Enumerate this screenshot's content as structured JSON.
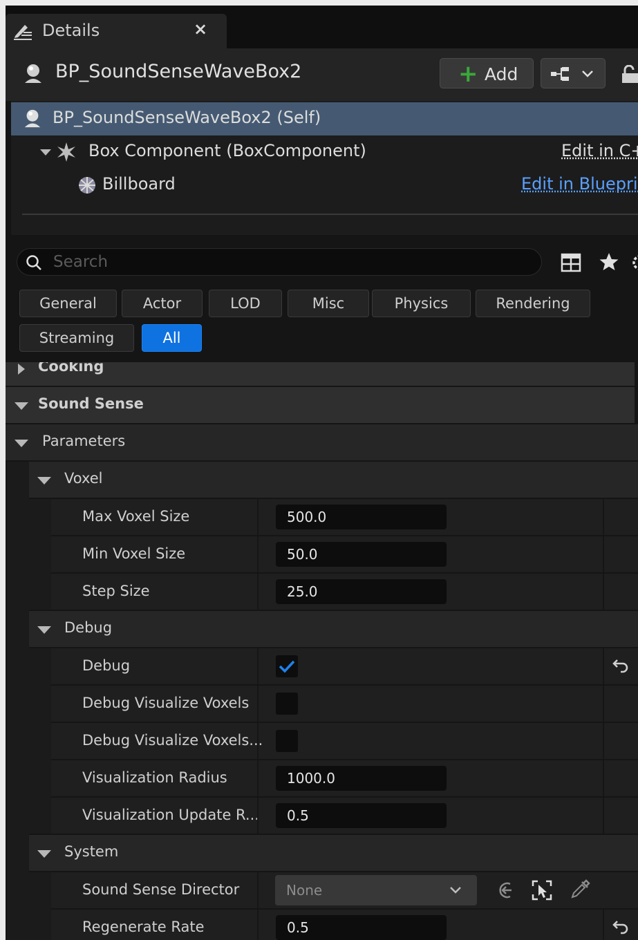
{
  "tab": {
    "title": "Details",
    "close": "×"
  },
  "header": {
    "actor_name": "BP_SoundSenseWaveBox2",
    "add_label": "Add",
    "add_symbol": "+"
  },
  "tree": {
    "self_label": "BP_SoundSenseWaveBox2 (Self)",
    "box_label": "Box Component (BoxComponent)",
    "box_link": "Edit in C++",
    "billboard_label": "Billboard",
    "billboard_link": "Edit in Blueprint"
  },
  "search": {
    "placeholder": "Search"
  },
  "filters": [
    "General",
    "Actor",
    "LOD",
    "Misc",
    "Physics",
    "Rendering",
    "Streaming",
    "All"
  ],
  "active_filter": "All",
  "categories": {
    "cooking": "Cooking",
    "sound_sense": "Sound Sense"
  },
  "parameters": {
    "label": "Parameters",
    "voxel": {
      "label": "Voxel",
      "max_voxel_size": {
        "label": "Max Voxel Size",
        "value": "500.0"
      },
      "min_voxel_size": {
        "label": "Min Voxel Size",
        "value": "50.0"
      },
      "step_size": {
        "label": "Step Size",
        "value": "25.0"
      }
    },
    "debug": {
      "label": "Debug",
      "debug": {
        "label": "Debug",
        "checked": true
      },
      "debug_visualize_voxels": {
        "label": "Debug Visualize Voxels",
        "checked": false
      },
      "debug_visualize_voxels_2": {
        "label": "Debug Visualize Voxels...",
        "checked": false
      },
      "visualization_radius": {
        "label": "Visualization Radius",
        "value": "1000.0"
      },
      "visualization_update_rate": {
        "label": "Visualization Update R...",
        "value": "0.5"
      }
    },
    "system": {
      "label": "System",
      "sound_sense_director": {
        "label": "Sound Sense Director",
        "value": "None"
      },
      "regenerate_rate": {
        "label": "Regenerate Rate",
        "value": "0.5"
      }
    }
  },
  "colors": {
    "accent": "#0e72e0",
    "selection": "#455a72",
    "link": "#5aa0ff",
    "add_plus": "#3aa83a"
  }
}
